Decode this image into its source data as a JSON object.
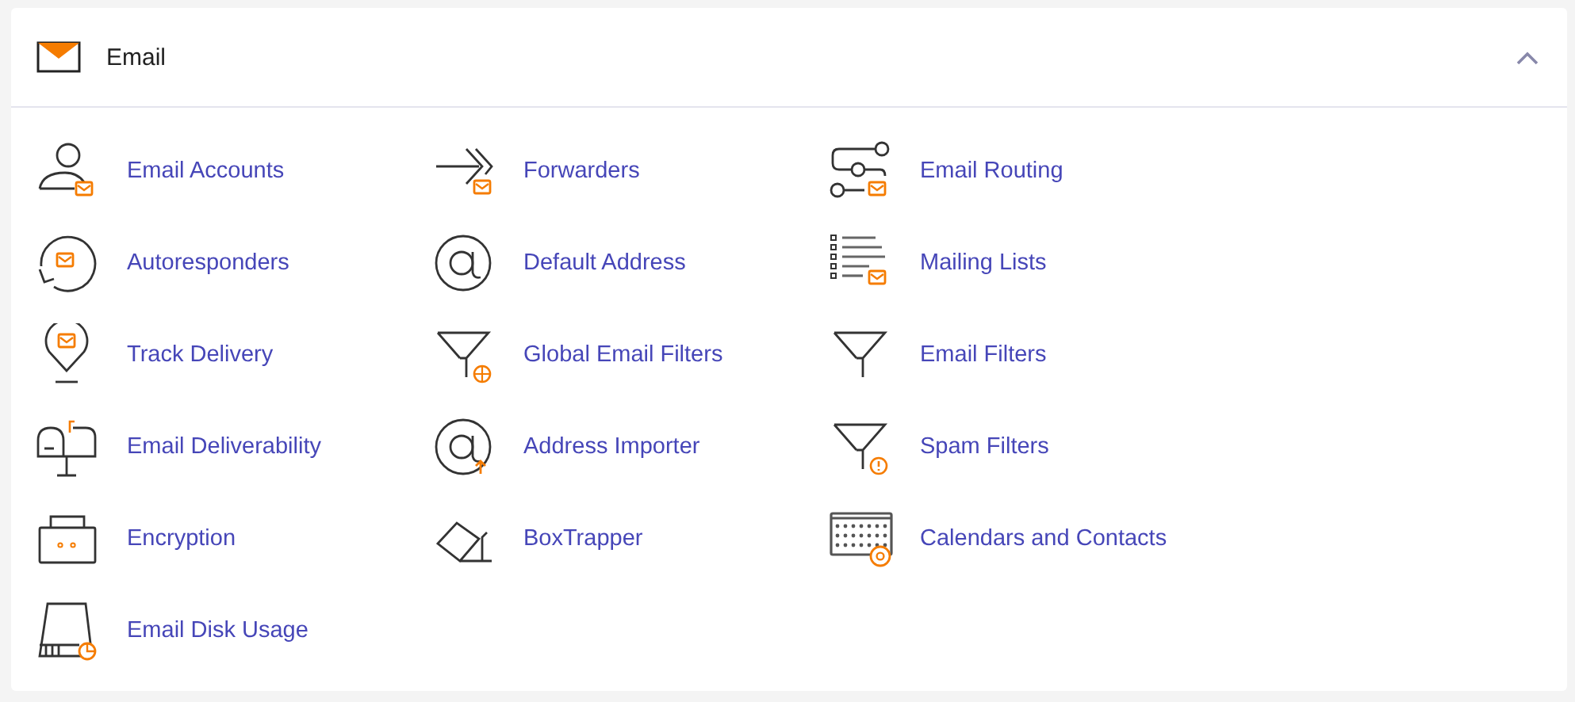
{
  "section": {
    "title": "Email",
    "expanded": true
  },
  "items": [
    {
      "label": "Email Accounts"
    },
    {
      "label": "Forwarders"
    },
    {
      "label": "Email Routing"
    },
    {
      "label": "Autoresponders"
    },
    {
      "label": "Default Address"
    },
    {
      "label": "Mailing Lists"
    },
    {
      "label": "Track Delivery"
    },
    {
      "label": "Global Email Filters"
    },
    {
      "label": "Email Filters"
    },
    {
      "label": "Email Deliverability"
    },
    {
      "label": "Address Importer"
    },
    {
      "label": "Spam Filters"
    },
    {
      "label": "Encryption"
    },
    {
      "label": "BoxTrapper"
    },
    {
      "label": "Calendars and Contacts"
    },
    {
      "label": "Email Disk Usage"
    }
  ]
}
